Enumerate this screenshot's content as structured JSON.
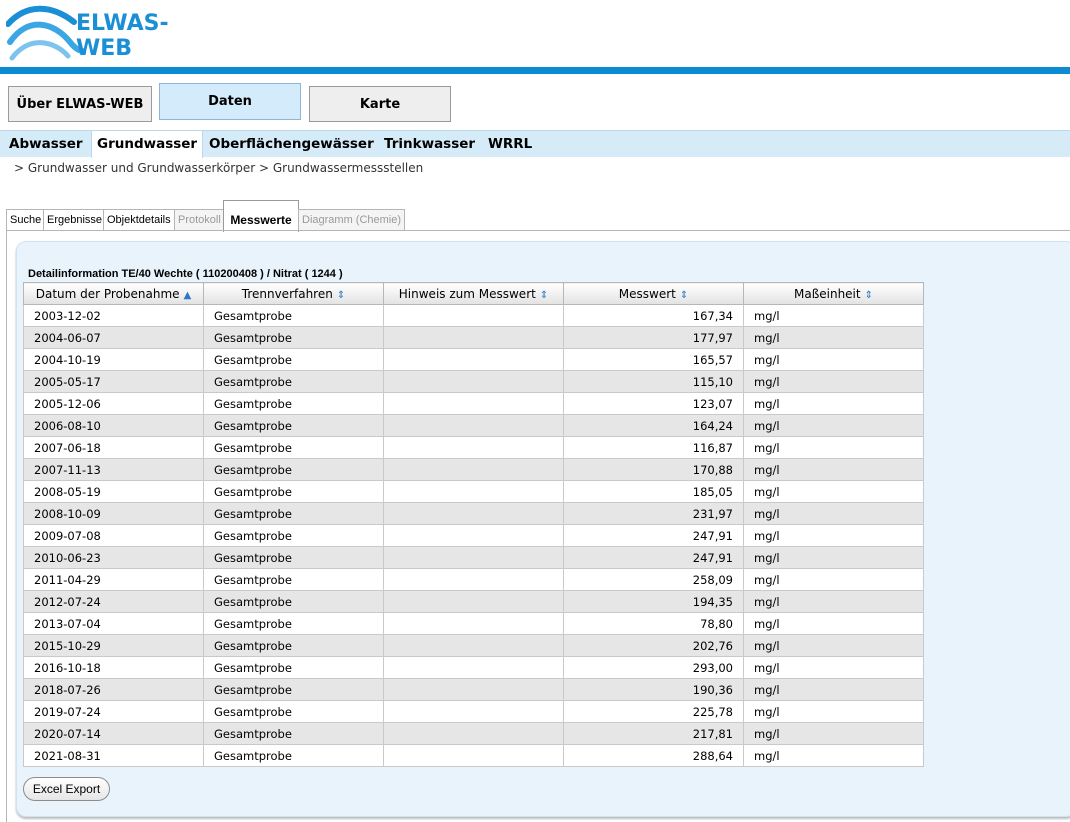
{
  "app": {
    "logo_text": "ELWAS-WEB"
  },
  "main_nav": [
    {
      "label": "Über ELWAS-WEB",
      "active": false
    },
    {
      "label": "Daten",
      "active": true
    },
    {
      "label": "Karte",
      "active": false
    }
  ],
  "sub_nav": [
    {
      "label": "Abwasser",
      "active": false
    },
    {
      "label": "Grundwasser",
      "active": true
    },
    {
      "label": "Oberflächengewässer",
      "active": false
    },
    {
      "label": "Trinkwasser",
      "active": false
    },
    {
      "label": "WRRL",
      "active": false
    }
  ],
  "breadcrumb": "> Grundwasser und Grundwasserkörper > Grundwassermessstellen",
  "tabs": [
    {
      "label": "Suche",
      "state": "enabled"
    },
    {
      "label": "Ergebnisse",
      "state": "enabled"
    },
    {
      "label": "Objektdetails",
      "state": "enabled"
    },
    {
      "label": "Protokoll",
      "state": "disabled"
    },
    {
      "label": "Messwerte",
      "state": "active"
    },
    {
      "label": "Diagramm (Chemie)",
      "state": "disabled"
    }
  ],
  "detail": {
    "title": "Detailinformation TE/40 Wechte ( 110200408 ) / Nitrat ( 1244 )",
    "columns": [
      {
        "label": "Datum der Probenahme",
        "sort_icon": "sort-ascending-icon",
        "glyph": "▲"
      },
      {
        "label": "Trennverfahren",
        "sort_icon": "sort-both-icon",
        "glyph": "⇕"
      },
      {
        "label": "Hinweis zum Messwert",
        "sort_icon": "sort-both-icon",
        "glyph": "⇕"
      },
      {
        "label": "Messwert",
        "sort_icon": "sort-both-icon",
        "glyph": "⇕"
      },
      {
        "label": "Maßeinheit",
        "sort_icon": "sort-both-icon",
        "glyph": "⇕"
      }
    ],
    "rows": [
      {
        "datum": "2003-12-02",
        "trenn": "Gesamtprobe",
        "hinweis": "",
        "wert": "167,34",
        "einheit": "mg/l"
      },
      {
        "datum": "2004-06-07",
        "trenn": "Gesamtprobe",
        "hinweis": "",
        "wert": "177,97",
        "einheit": "mg/l"
      },
      {
        "datum": "2004-10-19",
        "trenn": "Gesamtprobe",
        "hinweis": "",
        "wert": "165,57",
        "einheit": "mg/l"
      },
      {
        "datum": "2005-05-17",
        "trenn": "Gesamtprobe",
        "hinweis": "",
        "wert": "115,10",
        "einheit": "mg/l"
      },
      {
        "datum": "2005-12-06",
        "trenn": "Gesamtprobe",
        "hinweis": "",
        "wert": "123,07",
        "einheit": "mg/l"
      },
      {
        "datum": "2006-08-10",
        "trenn": "Gesamtprobe",
        "hinweis": "",
        "wert": "164,24",
        "einheit": "mg/l"
      },
      {
        "datum": "2007-06-18",
        "trenn": "Gesamtprobe",
        "hinweis": "",
        "wert": "116,87",
        "einheit": "mg/l"
      },
      {
        "datum": "2007-11-13",
        "trenn": "Gesamtprobe",
        "hinweis": "",
        "wert": "170,88",
        "einheit": "mg/l"
      },
      {
        "datum": "2008-05-19",
        "trenn": "Gesamtprobe",
        "hinweis": "",
        "wert": "185,05",
        "einheit": "mg/l"
      },
      {
        "datum": "2008-10-09",
        "trenn": "Gesamtprobe",
        "hinweis": "",
        "wert": "231,97",
        "einheit": "mg/l"
      },
      {
        "datum": "2009-07-08",
        "trenn": "Gesamtprobe",
        "hinweis": "",
        "wert": "247,91",
        "einheit": "mg/l"
      },
      {
        "datum": "2010-06-23",
        "trenn": "Gesamtprobe",
        "hinweis": "",
        "wert": "247,91",
        "einheit": "mg/l"
      },
      {
        "datum": "2011-04-29",
        "trenn": "Gesamtprobe",
        "hinweis": "",
        "wert": "258,09",
        "einheit": "mg/l"
      },
      {
        "datum": "2012-07-24",
        "trenn": "Gesamtprobe",
        "hinweis": "",
        "wert": "194,35",
        "einheit": "mg/l"
      },
      {
        "datum": "2013-07-04",
        "trenn": "Gesamtprobe",
        "hinweis": "",
        "wert": "78,80",
        "einheit": "mg/l"
      },
      {
        "datum": "2015-10-29",
        "trenn": "Gesamtprobe",
        "hinweis": "",
        "wert": "202,76",
        "einheit": "mg/l"
      },
      {
        "datum": "2016-10-18",
        "trenn": "Gesamtprobe",
        "hinweis": "",
        "wert": "293,00",
        "einheit": "mg/l"
      },
      {
        "datum": "2018-07-26",
        "trenn": "Gesamtprobe",
        "hinweis": "",
        "wert": "190,36",
        "einheit": "mg/l"
      },
      {
        "datum": "2019-07-24",
        "trenn": "Gesamtprobe",
        "hinweis": "",
        "wert": "225,78",
        "einheit": "mg/l"
      },
      {
        "datum": "2020-07-14",
        "trenn": "Gesamtprobe",
        "hinweis": "",
        "wert": "217,81",
        "einheit": "mg/l"
      },
      {
        "datum": "2021-08-31",
        "trenn": "Gesamtprobe",
        "hinweis": "",
        "wert": "288,64",
        "einheit": "mg/l"
      }
    ],
    "export_label": "Excel Export"
  },
  "colors": {
    "brand_blue": "#0c8bd2",
    "subnav_bg": "#d6ebf8",
    "panel_bg": "#e8f3fc",
    "row_alt": "#e6e6e6"
  }
}
